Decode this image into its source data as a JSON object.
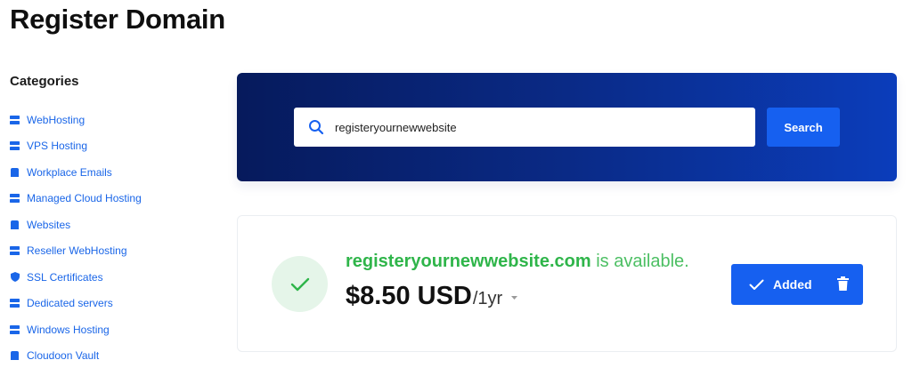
{
  "page": {
    "title": "Register Domain"
  },
  "sidebar": {
    "title": "Categories",
    "items": [
      {
        "label": "WebHosting",
        "icon": "server-icon"
      },
      {
        "label": "VPS Hosting",
        "icon": "server-icon"
      },
      {
        "label": "Workplace Emails",
        "icon": "mailbox-icon"
      },
      {
        "label": "Managed Cloud Hosting",
        "icon": "server-icon"
      },
      {
        "label": "Websites",
        "icon": "box-icon"
      },
      {
        "label": "Reseller WebHosting",
        "icon": "server-icon"
      },
      {
        "label": "SSL Certificates",
        "icon": "shield-icon"
      },
      {
        "label": "Dedicated servers",
        "icon": "server-icon"
      },
      {
        "label": "Windows Hosting",
        "icon": "server-icon"
      },
      {
        "label": "Cloudoon Vault",
        "icon": "box-icon"
      }
    ]
  },
  "search": {
    "value": "registeryournewwebsite",
    "button_label": "Search"
  },
  "result": {
    "domain": "registeryournewwebsite.com",
    "status_text": "is available.",
    "price": "$8.50 USD",
    "period": "/1yr",
    "added_label": "Added"
  },
  "colors": {
    "accent": "#1660f0",
    "available_green": "#2fb54a",
    "panel_dark": "#061a5c",
    "panel_light": "#0b3dbb"
  }
}
